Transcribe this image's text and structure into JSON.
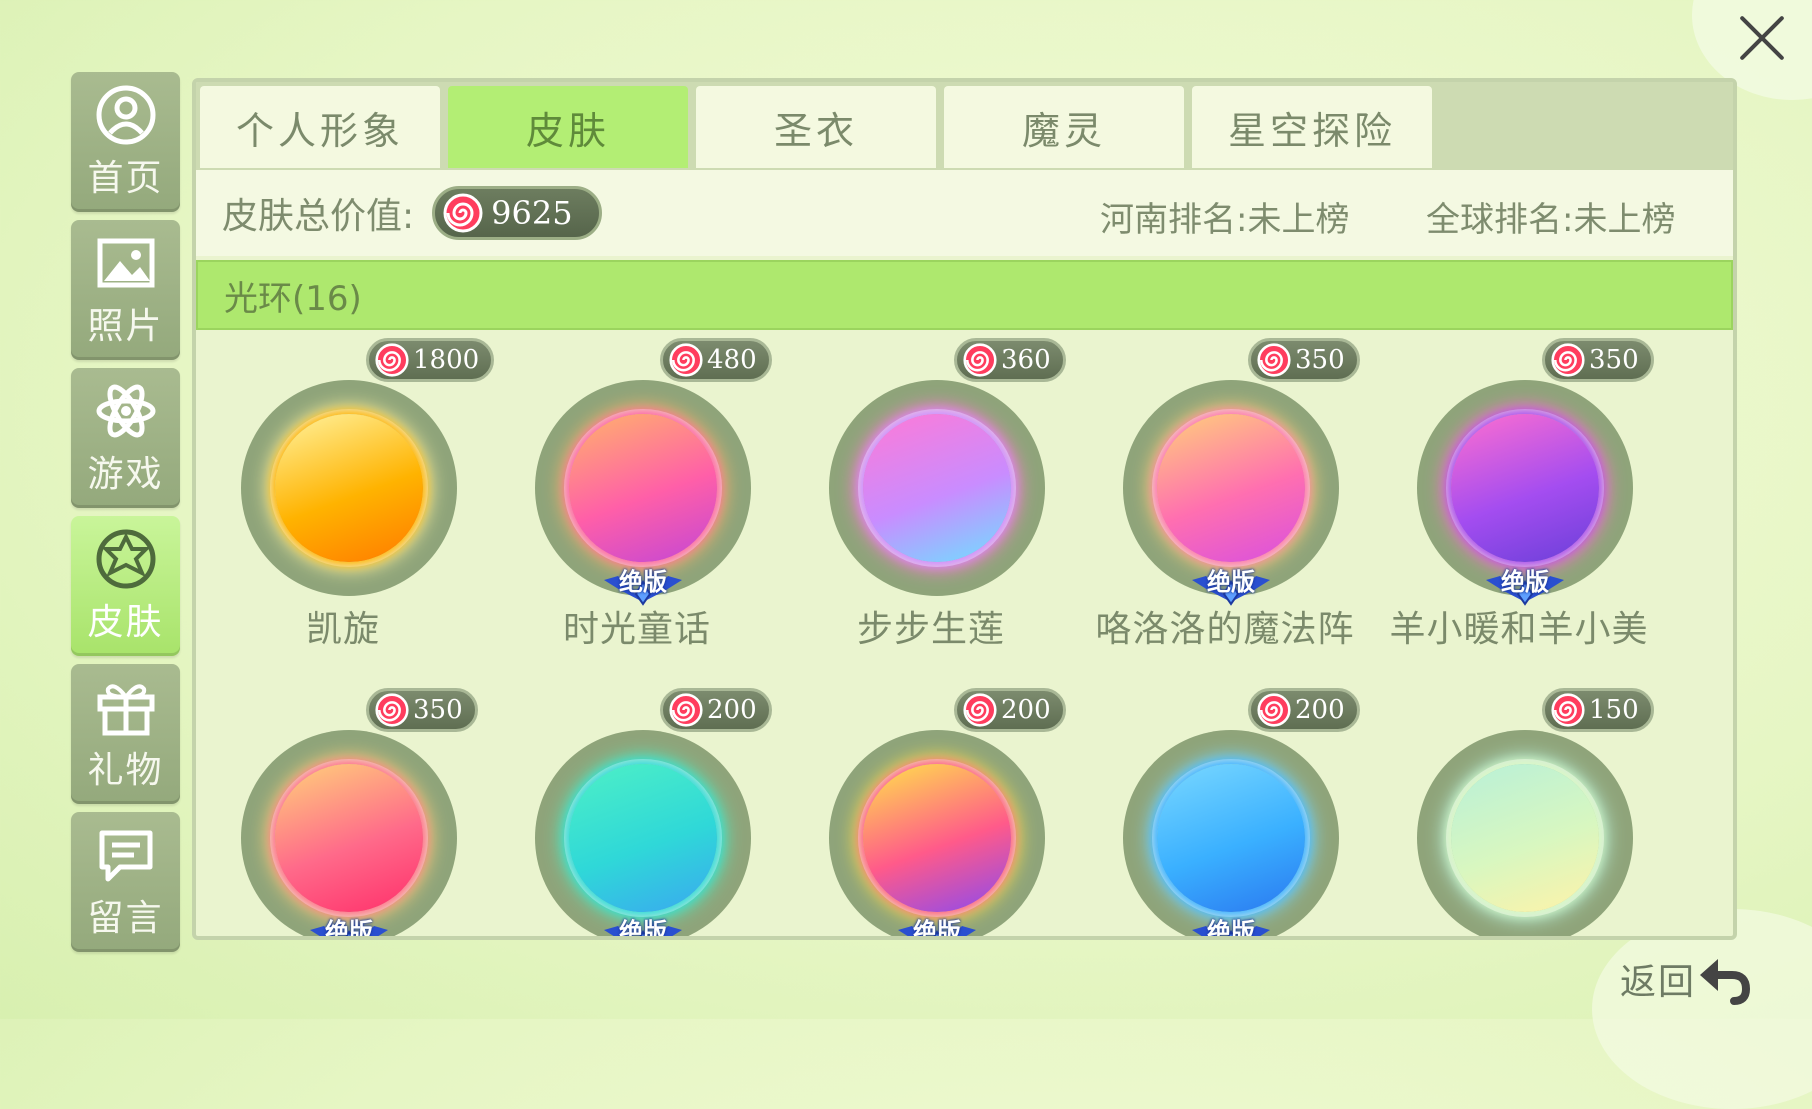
{
  "sidebar": {
    "items": [
      {
        "label": "首页",
        "icon": "user-icon"
      },
      {
        "label": "照片",
        "icon": "photo-icon"
      },
      {
        "label": "游戏",
        "icon": "atom-icon"
      },
      {
        "label": "皮肤",
        "icon": "star-badge-icon"
      },
      {
        "label": "礼物",
        "icon": "gift-icon"
      },
      {
        "label": "留言",
        "icon": "message-icon"
      }
    ],
    "active_index": 3
  },
  "tabs": [
    {
      "label": "个人形象"
    },
    {
      "label": "皮肤"
    },
    {
      "label": "圣衣"
    },
    {
      "label": "魔灵"
    },
    {
      "label": "星空探险"
    }
  ],
  "active_tab": 1,
  "info": {
    "total_label": "皮肤总价值:",
    "total_value": "9625",
    "henan_rank": "河南排名:未上榜",
    "global_rank": "全球排名:未上榜"
  },
  "section": {
    "title": "光环(16)"
  },
  "items": [
    {
      "name": "凯旋",
      "price": "1800",
      "limited": false,
      "colors": [
        "#fff3a0",
        "#ffb300",
        "#ff7a00"
      ]
    },
    {
      "name": "时光童话",
      "price": "480",
      "limited": true,
      "colors": [
        "#ffb36b",
        "#ff5fa8",
        "#c346d6"
      ]
    },
    {
      "name": "步步生莲",
      "price": "360",
      "limited": false,
      "colors": [
        "#ff7ad6",
        "#c98cff",
        "#6ee0ff"
      ]
    },
    {
      "name": "咯洛洛的魔法阵",
      "price": "350",
      "limited": true,
      "colors": [
        "#ffd07a",
        "#ff6fb0",
        "#d84fe0"
      ]
    },
    {
      "name": "羊小暖和羊小美",
      "price": "350",
      "limited": true,
      "colors": [
        "#ff6fcf",
        "#a44df0",
        "#6a3fd8"
      ]
    },
    {
      "name": "",
      "price": "350",
      "limited": true,
      "colors": [
        "#ffd27a",
        "#ff6a8a",
        "#ff2f6a"
      ]
    },
    {
      "name": "",
      "price": "200",
      "limited": true,
      "colors": [
        "#4ef0c6",
        "#2fd8d8",
        "#3aa8f0"
      ]
    },
    {
      "name": "",
      "price": "200",
      "limited": true,
      "colors": [
        "#ffe44a",
        "#ff5a8a",
        "#8a4af0"
      ]
    },
    {
      "name": "",
      "price": "200",
      "limited": true,
      "colors": [
        "#7ad8ff",
        "#3ab0ff",
        "#2a78f0"
      ]
    },
    {
      "name": "",
      "price": "150",
      "limited": false,
      "colors": [
        "#b8f0d8",
        "#d8f7c0",
        "#fff2a8"
      ]
    }
  ],
  "limited_label": "绝版",
  "back": {
    "label": "返回"
  }
}
